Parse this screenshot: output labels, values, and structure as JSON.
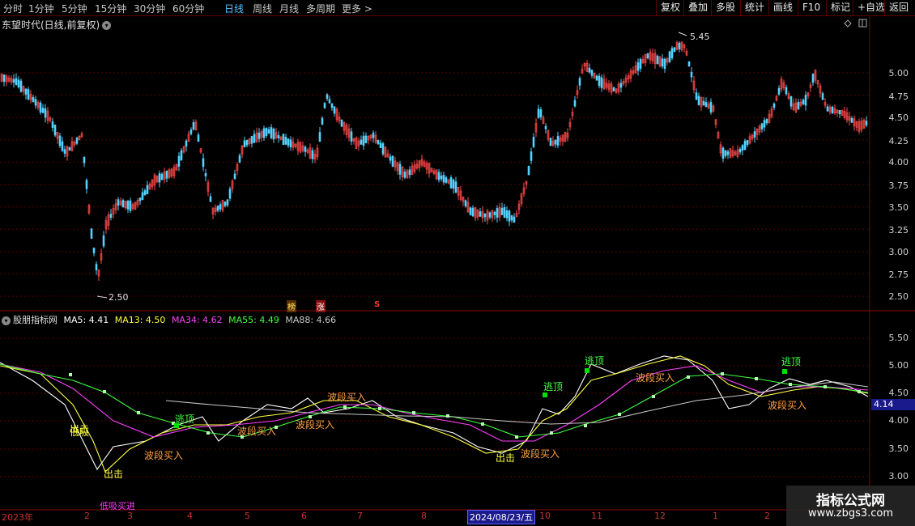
{
  "toolbar": {
    "periods": [
      "分时",
      "1分钟",
      "5分钟",
      "15分钟",
      "30分钟",
      "60分钟",
      "日线",
      "周线",
      "月线",
      "多周期",
      "更多 >"
    ],
    "active_period": "日线",
    "buttons": [
      "复权",
      "叠加",
      "多股",
      "统计",
      "画线",
      "F10",
      "标记",
      "+自选",
      "返回"
    ]
  },
  "main_chart": {
    "title": "东望时代(日线,前复权)",
    "high_label": "5.45",
    "low_label": "2.50",
    "price_ticks": [
      "5.00",
      "4.75",
      "4.50",
      "4.25",
      "4.00",
      "3.75",
      "3.50",
      "3.25",
      "3.00",
      "2.75",
      "2.50"
    ],
    "markers": [
      "榜",
      "涨",
      "S"
    ]
  },
  "indicator": {
    "name": "股朋指标网",
    "ma5_label": "MA5: 4.41",
    "ma13_label": "MA13: 4.50",
    "ma34_label": "MA34: 4.62",
    "ma55_label": "MA55: 4.49",
    "ma88_label": "MA88: 4.66",
    "ticks": [
      "5.50",
      "5.00",
      "4.50",
      "4.00",
      "3.50",
      "3.00"
    ],
    "current_value": "4.14",
    "annotations": [
      "逃顶",
      "逃顶",
      "逃顶",
      "逃顶",
      "波段买入",
      "波段买入",
      "波段买入",
      "波段买入",
      "波段买入",
      "波段买入",
      "波段买入",
      "出击",
      "出击",
      "出击",
      "低吸",
      "低吸买进"
    ]
  },
  "date_axis": {
    "labels": [
      "2023年",
      "2",
      "3",
      "4",
      "5",
      "6",
      "7",
      "8",
      "10",
      "11",
      "12",
      "1",
      "2"
    ],
    "selected_date": "2024/08/23/五"
  },
  "watermark": {
    "line1": "指标公式网",
    "line2": "www.zbgs3.com"
  },
  "colors": {
    "up": "#ff4a4a",
    "down": "#54d2ff",
    "ma5": "#ffffff",
    "ma13": "#ffff40",
    "ma34": "#ff40ff",
    "ma55": "#40ff40",
    "ma88": "#c8c8c8",
    "grid": "#5a0000"
  }
}
